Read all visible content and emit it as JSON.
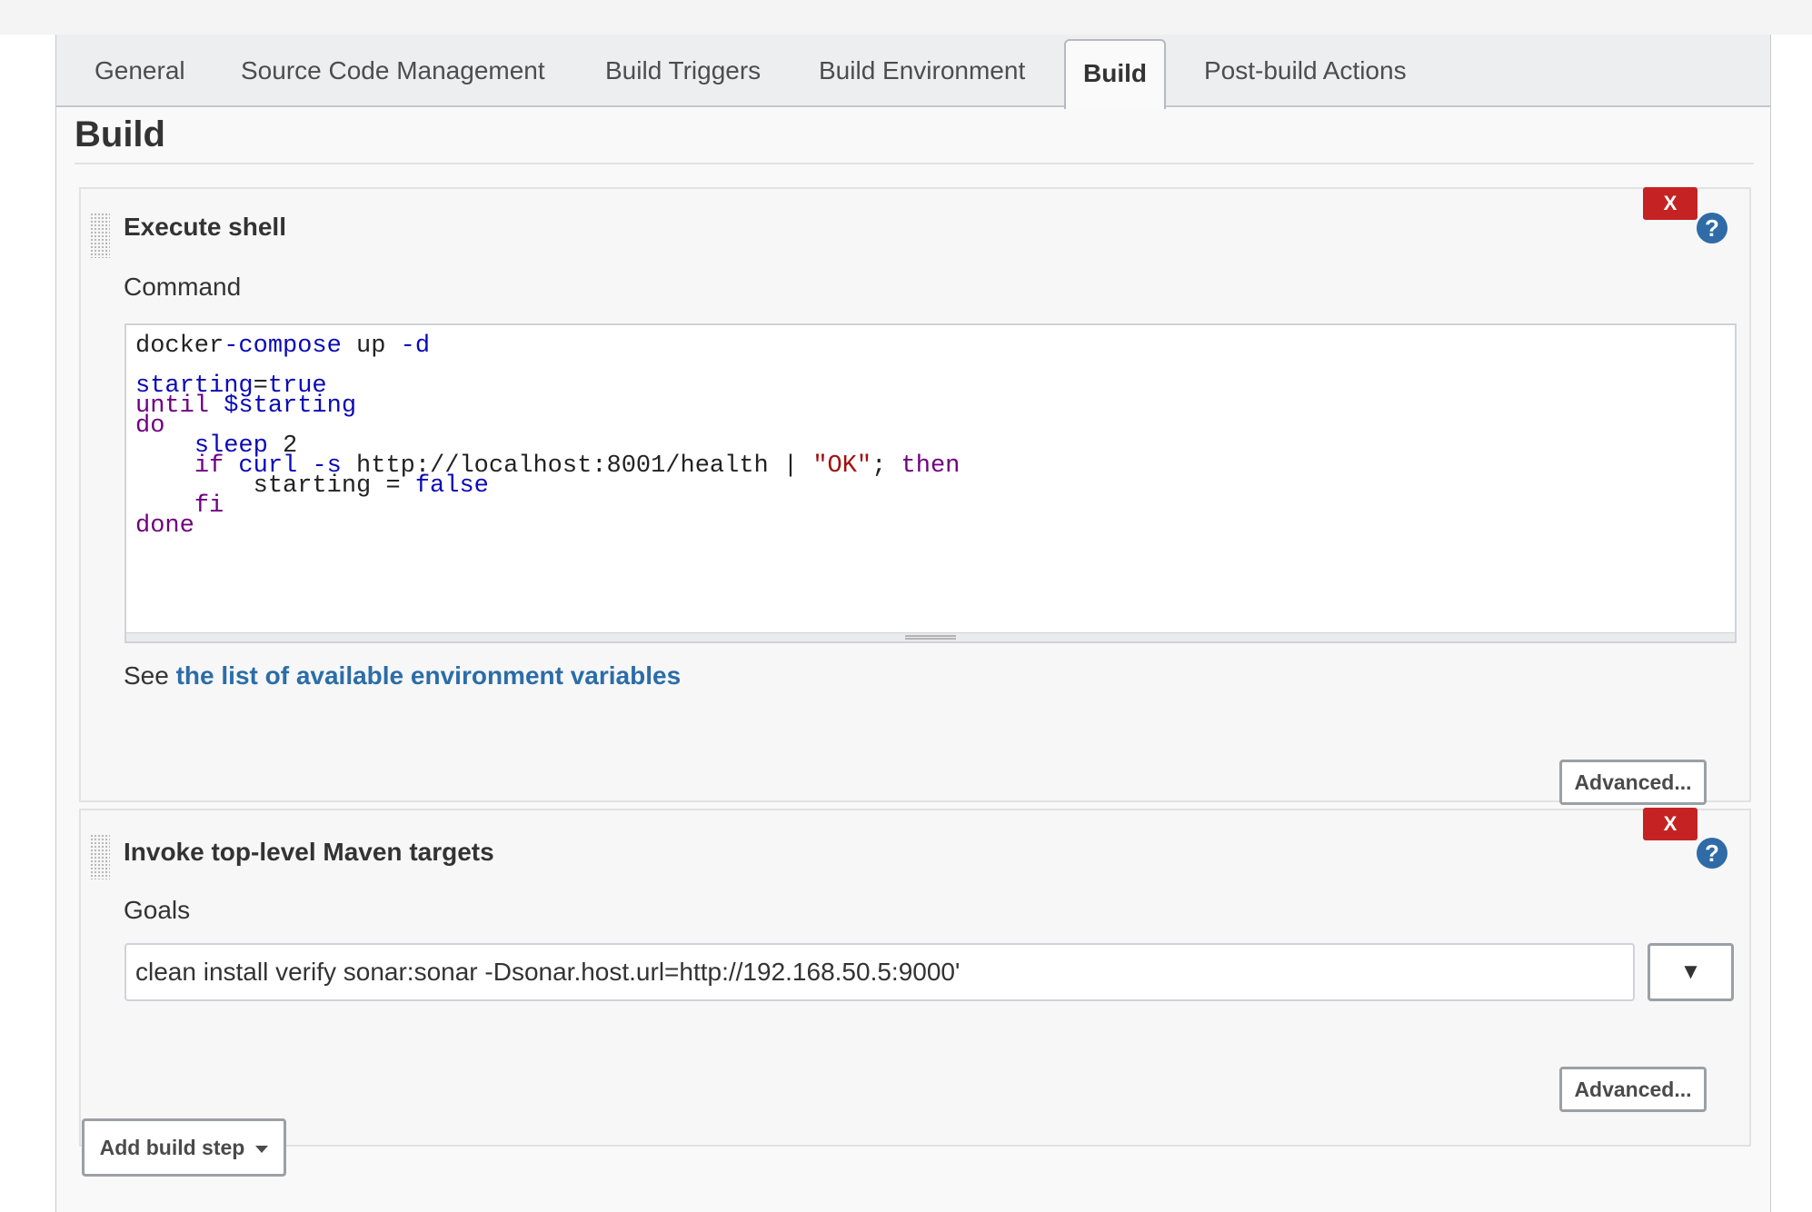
{
  "tabs": [
    "General",
    "Source Code Management",
    "Build Triggers",
    "Build Environment",
    "Build",
    "Post-build Actions"
  ],
  "active_tab": "Build",
  "section_title": "Build",
  "steps": {
    "shell": {
      "title": "Execute shell",
      "delete_label": "X",
      "help_label": "?",
      "field_label": "Command",
      "command_lines": [
        "docker-compose up -d",
        "",
        "starting=true",
        "until $starting",
        "do",
        "    sleep 2",
        "    if curl -s http://localhost:8001/health | \"OK\"; then",
        "        starting = false",
        "    fi",
        "done"
      ],
      "env_prefix": "See ",
      "env_link": "the list of available environment variables",
      "advanced_label": "Advanced..."
    },
    "maven": {
      "title": "Invoke top-level Maven targets",
      "delete_label": "X",
      "help_label": "?",
      "field_label": "Goals",
      "goals_value": "clean install verify sonar:sonar -Dsonar.host.url=http://192.168.50.5:9000'",
      "expand_label": "▼",
      "advanced_label": "Advanced..."
    }
  },
  "add_step_label": "Add build step",
  "colors": {
    "delete": "#c52323",
    "help": "#2f6ba6",
    "link": "#2b6da8",
    "keyword": "#700080",
    "definition": "#0a0ab8",
    "string": "#a11111"
  }
}
